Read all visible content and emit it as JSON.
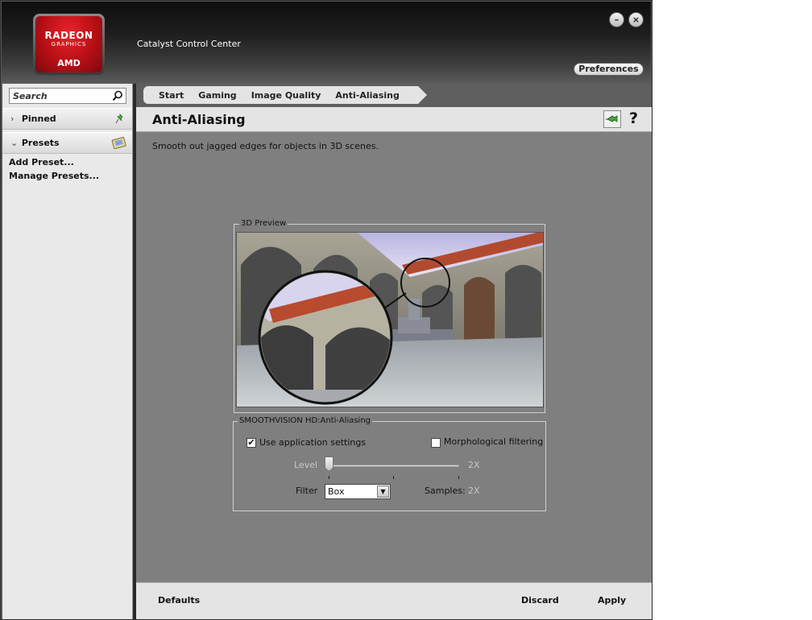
{
  "app": {
    "title": "Catalyst Control Center",
    "logo": {
      "line1": "RADEON",
      "line2": "GRAPHICS",
      "line3": "AMD"
    },
    "minimize_label": "–",
    "close_label": "×",
    "preferences_label": "Preferences"
  },
  "sidebar": {
    "search_placeholder": "Search",
    "pinned_label": "Pinned",
    "presets_label": "Presets",
    "pinned_chevron": "›",
    "presets_chevron": "⌄",
    "links": [
      "Add Preset...",
      "Manage Presets..."
    ]
  },
  "breadcrumb": [
    "Start",
    "Gaming",
    "Image Quality",
    "Anti-Aliasing"
  ],
  "page": {
    "title": "Anti-Aliasing",
    "help_label": "?",
    "description": "Smooth out jagged edges for objects in 3D scenes."
  },
  "preview": {
    "legend": "3D Preview"
  },
  "smoothvision": {
    "legend": "SMOOTHVISION HD:Anti-Aliasing",
    "use_app_settings_label": "Use application settings",
    "use_app_settings_checked": true,
    "check_mark": "✔",
    "morphological_label": "Morphological filtering",
    "morphological_checked": false,
    "level_label": "Level",
    "level_value": "2X",
    "level_fraction": 0.0,
    "filter_label": "Filter",
    "filter_value": "Box",
    "filter_arrow": "▼",
    "samples_label": "Samples:",
    "samples_value": "2X"
  },
  "footer": {
    "defaults_label": "Defaults",
    "discard_label": "Discard",
    "apply_label": "Apply"
  },
  "colors": {
    "radeon_red": "#c8161d",
    "content_bg": "#7f7f7f",
    "panel_bg": "#e4e4e4"
  }
}
